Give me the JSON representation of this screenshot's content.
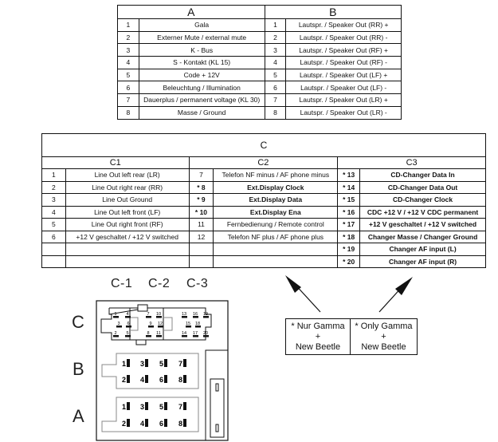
{
  "table_ab": {
    "header_a": "A",
    "header_b": "B",
    "rows": [
      {
        "a_pin": "1",
        "a_desc": "Gala",
        "b_pin": "1",
        "b_desc": "Lautspr. / Speaker Out (RR) +"
      },
      {
        "a_pin": "2",
        "a_desc": "Externer Mute / external mute",
        "b_pin": "2",
        "b_desc": "Lautspr. / Speaker Out (RR) -"
      },
      {
        "a_pin": "3",
        "a_desc": "K - Bus",
        "b_pin": "3",
        "b_desc": "Lautspr. / Speaker Out (RF) +"
      },
      {
        "a_pin": "4",
        "a_desc": "S - Kontakt (KL 15)",
        "b_pin": "4",
        "b_desc": "Lautspr. / Speaker Out (RF) -"
      },
      {
        "a_pin": "5",
        "a_desc": "Code + 12V",
        "b_pin": "5",
        "b_desc": "Lautspr. / Speaker Out (LF) +"
      },
      {
        "a_pin": "6",
        "a_desc": "Beleuchtung / Illumination",
        "b_pin": "6",
        "b_desc": "Lautspr. / Speaker Out (LF) -"
      },
      {
        "a_pin": "7",
        "a_desc": "Dauerplus / permanent voltage (KL 30)",
        "b_pin": "7",
        "b_desc": "Lautspr. / Speaker Out (LR) +"
      },
      {
        "a_pin": "8",
        "a_desc": "Masse / Ground",
        "b_pin": "8",
        "b_desc": "Lautspr. / Speaker Out (LR) -"
      }
    ]
  },
  "table_c": {
    "header": "C",
    "header_c1": "C1",
    "header_c2": "C2",
    "header_c3": "C3",
    "rows": [
      {
        "c1_pin": "1",
        "c1_desc": "Line Out left rear (LR)",
        "c2_pin": "7",
        "c2_desc": "Telefon NF minus / AF phone minus",
        "c3_pin": "* 13",
        "c3_desc": "CD-Changer Data In"
      },
      {
        "c1_pin": "2",
        "c1_desc": "Line Out right rear (RR)",
        "c2_pin": "* 8",
        "c2_desc": "Ext.Display Clock",
        "c3_pin": "* 14",
        "c3_desc": "CD-Changer Data Out"
      },
      {
        "c1_pin": "3",
        "c1_desc": "Line Out Ground",
        "c2_pin": "* 9",
        "c2_desc": "Ext.Display Data",
        "c3_pin": "* 15",
        "c3_desc": "CD-Changer Clock"
      },
      {
        "c1_pin": "4",
        "c1_desc": "Line Out left front (LF)",
        "c2_pin": "* 10",
        "c2_desc": "Ext.Display Ena",
        "c3_pin": "* 16",
        "c3_desc": "CDC +12 V / +12 V CDC permanent"
      },
      {
        "c1_pin": "5",
        "c1_desc": "Line Out right front (RF)",
        "c2_pin": "11",
        "c2_desc": "Fernbedienung / Remote control",
        "c3_pin": "* 17",
        "c3_desc": "+12 V geschaltet / +12 V switched"
      },
      {
        "c1_pin": "6",
        "c1_desc": "+12 V geschaltet / +12 V switched",
        "c2_pin": "12",
        "c2_desc": "Telefon NF plus / AF phone plus",
        "c3_pin": "* 18",
        "c3_desc": "Changer Masse / Changer Ground"
      },
      {
        "c1_pin": "",
        "c1_desc": "",
        "c2_pin": "",
        "c2_desc": "",
        "c3_pin": "* 19",
        "c3_desc": "Changer AF input (L)"
      },
      {
        "c1_pin": "",
        "c1_desc": "",
        "c2_pin": "",
        "c2_desc": "",
        "c3_pin": "* 20",
        "c3_desc": "Changer AF input (R)"
      }
    ]
  },
  "connector": {
    "section_labels": {
      "c": "C",
      "b": "B",
      "a": "A"
    },
    "column_labels": [
      "C-1",
      "C-2",
      "C-3"
    ],
    "c_pins": [
      "1",
      "4",
      "3",
      "6",
      "2",
      "5",
      "7",
      "10",
      "9",
      "12",
      "8",
      "11",
      "13",
      "16",
      "19",
      "15",
      "18",
      "14",
      "17",
      "20"
    ],
    "b_pins": [
      "1",
      "3",
      "5",
      "7",
      "2",
      "4",
      "6",
      "8"
    ],
    "a_pins": [
      "1",
      "3",
      "5",
      "7",
      "2",
      "4",
      "6",
      "8"
    ]
  },
  "notes": {
    "left": [
      "* Nur Gamma",
      "+",
      "New Beetle"
    ],
    "right": [
      "* Only Gamma",
      "+",
      "New Beetle"
    ]
  }
}
